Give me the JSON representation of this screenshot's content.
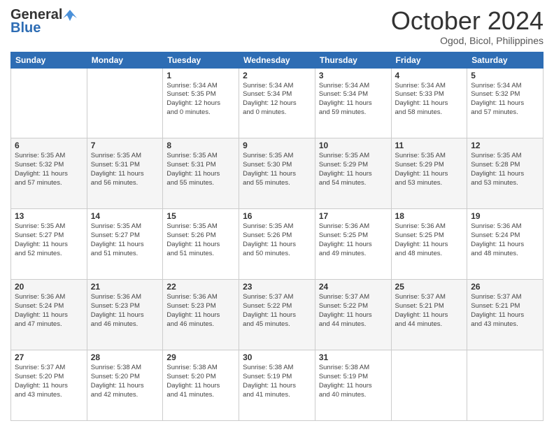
{
  "header": {
    "logo_general": "General",
    "logo_blue": "Blue",
    "month_title": "October 2024",
    "location": "Ogod, Bicol, Philippines"
  },
  "weekdays": [
    "Sunday",
    "Monday",
    "Tuesday",
    "Wednesday",
    "Thursday",
    "Friday",
    "Saturday"
  ],
  "weeks": [
    [
      {
        "day": "",
        "info": ""
      },
      {
        "day": "",
        "info": ""
      },
      {
        "day": "1",
        "info": "Sunrise: 5:34 AM\nSunset: 5:35 PM\nDaylight: 12 hours\nand 0 minutes."
      },
      {
        "day": "2",
        "info": "Sunrise: 5:34 AM\nSunset: 5:34 PM\nDaylight: 12 hours\nand 0 minutes."
      },
      {
        "day": "3",
        "info": "Sunrise: 5:34 AM\nSunset: 5:34 PM\nDaylight: 11 hours\nand 59 minutes."
      },
      {
        "day": "4",
        "info": "Sunrise: 5:34 AM\nSunset: 5:33 PM\nDaylight: 11 hours\nand 58 minutes."
      },
      {
        "day": "5",
        "info": "Sunrise: 5:34 AM\nSunset: 5:32 PM\nDaylight: 11 hours\nand 57 minutes."
      }
    ],
    [
      {
        "day": "6",
        "info": "Sunrise: 5:35 AM\nSunset: 5:32 PM\nDaylight: 11 hours\nand 57 minutes."
      },
      {
        "day": "7",
        "info": "Sunrise: 5:35 AM\nSunset: 5:31 PM\nDaylight: 11 hours\nand 56 minutes."
      },
      {
        "day": "8",
        "info": "Sunrise: 5:35 AM\nSunset: 5:31 PM\nDaylight: 11 hours\nand 55 minutes."
      },
      {
        "day": "9",
        "info": "Sunrise: 5:35 AM\nSunset: 5:30 PM\nDaylight: 11 hours\nand 55 minutes."
      },
      {
        "day": "10",
        "info": "Sunrise: 5:35 AM\nSunset: 5:29 PM\nDaylight: 11 hours\nand 54 minutes."
      },
      {
        "day": "11",
        "info": "Sunrise: 5:35 AM\nSunset: 5:29 PM\nDaylight: 11 hours\nand 53 minutes."
      },
      {
        "day": "12",
        "info": "Sunrise: 5:35 AM\nSunset: 5:28 PM\nDaylight: 11 hours\nand 53 minutes."
      }
    ],
    [
      {
        "day": "13",
        "info": "Sunrise: 5:35 AM\nSunset: 5:27 PM\nDaylight: 11 hours\nand 52 minutes."
      },
      {
        "day": "14",
        "info": "Sunrise: 5:35 AM\nSunset: 5:27 PM\nDaylight: 11 hours\nand 51 minutes."
      },
      {
        "day": "15",
        "info": "Sunrise: 5:35 AM\nSunset: 5:26 PM\nDaylight: 11 hours\nand 51 minutes."
      },
      {
        "day": "16",
        "info": "Sunrise: 5:35 AM\nSunset: 5:26 PM\nDaylight: 11 hours\nand 50 minutes."
      },
      {
        "day": "17",
        "info": "Sunrise: 5:36 AM\nSunset: 5:25 PM\nDaylight: 11 hours\nand 49 minutes."
      },
      {
        "day": "18",
        "info": "Sunrise: 5:36 AM\nSunset: 5:25 PM\nDaylight: 11 hours\nand 48 minutes."
      },
      {
        "day": "19",
        "info": "Sunrise: 5:36 AM\nSunset: 5:24 PM\nDaylight: 11 hours\nand 48 minutes."
      }
    ],
    [
      {
        "day": "20",
        "info": "Sunrise: 5:36 AM\nSunset: 5:24 PM\nDaylight: 11 hours\nand 47 minutes."
      },
      {
        "day": "21",
        "info": "Sunrise: 5:36 AM\nSunset: 5:23 PM\nDaylight: 11 hours\nand 46 minutes."
      },
      {
        "day": "22",
        "info": "Sunrise: 5:36 AM\nSunset: 5:23 PM\nDaylight: 11 hours\nand 46 minutes."
      },
      {
        "day": "23",
        "info": "Sunrise: 5:37 AM\nSunset: 5:22 PM\nDaylight: 11 hours\nand 45 minutes."
      },
      {
        "day": "24",
        "info": "Sunrise: 5:37 AM\nSunset: 5:22 PM\nDaylight: 11 hours\nand 44 minutes."
      },
      {
        "day": "25",
        "info": "Sunrise: 5:37 AM\nSunset: 5:21 PM\nDaylight: 11 hours\nand 44 minutes."
      },
      {
        "day": "26",
        "info": "Sunrise: 5:37 AM\nSunset: 5:21 PM\nDaylight: 11 hours\nand 43 minutes."
      }
    ],
    [
      {
        "day": "27",
        "info": "Sunrise: 5:37 AM\nSunset: 5:20 PM\nDaylight: 11 hours\nand 43 minutes."
      },
      {
        "day": "28",
        "info": "Sunrise: 5:38 AM\nSunset: 5:20 PM\nDaylight: 11 hours\nand 42 minutes."
      },
      {
        "day": "29",
        "info": "Sunrise: 5:38 AM\nSunset: 5:20 PM\nDaylight: 11 hours\nand 41 minutes."
      },
      {
        "day": "30",
        "info": "Sunrise: 5:38 AM\nSunset: 5:19 PM\nDaylight: 11 hours\nand 41 minutes."
      },
      {
        "day": "31",
        "info": "Sunrise: 5:38 AM\nSunset: 5:19 PM\nDaylight: 11 hours\nand 40 minutes."
      },
      {
        "day": "",
        "info": ""
      },
      {
        "day": "",
        "info": ""
      }
    ]
  ]
}
